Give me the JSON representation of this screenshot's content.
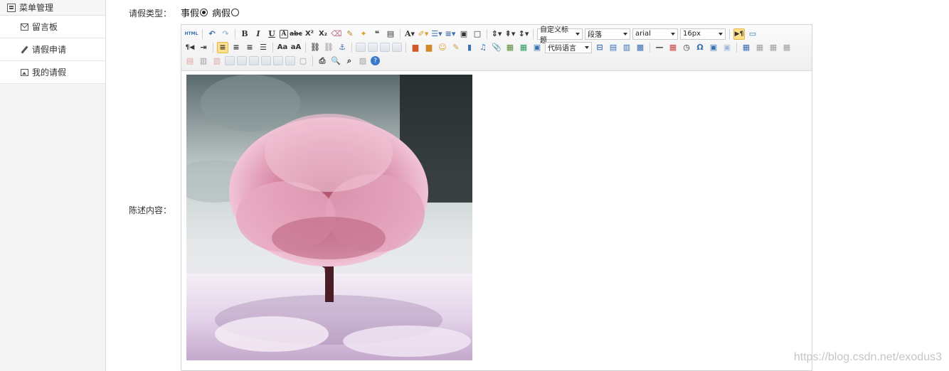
{
  "sidebar": {
    "header": {
      "label": "菜单管理",
      "icon": "menu-book-icon"
    },
    "items": [
      {
        "label": "留言板",
        "icon": "mail-icon"
      },
      {
        "label": "请假申请",
        "icon": "pen-icon"
      },
      {
        "label": "我的请假",
        "icon": "picture-icon"
      }
    ]
  },
  "form": {
    "leave_type_label": "请假类型：",
    "options": [
      {
        "label": "事假",
        "checked": true
      },
      {
        "label": "病假",
        "checked": false
      }
    ],
    "content_label": "陈述内容："
  },
  "editor": {
    "toolbar": {
      "html_label": "HTML",
      "title_select": "自定义标题",
      "paragraph_select": "段落",
      "font_select": "arial",
      "size_select": "16px",
      "code_lang_select": "代码语言"
    },
    "image": {
      "subject": "pink-tree-photo"
    }
  },
  "watermark": "https://blog.csdn.net/exodus3",
  "colors": {
    "sidebar_bg": "#f4f4f4",
    "toolbar_bg": "#efefef",
    "help_blue": "#3a79c9",
    "active_highlight": "#ffe08a"
  }
}
